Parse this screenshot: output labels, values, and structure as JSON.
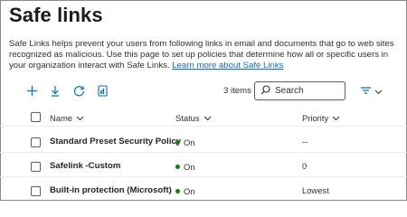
{
  "page": {
    "title": "Safe links",
    "description": "Safe Links helps prevent your users from following links in email and documents that go to web sites recognized as malicious. Use this page to set up policies that determine how all or specific users in your organization interact with Safe Links.",
    "learn_more": "Learn more about Safe Links"
  },
  "toolbar": {
    "items_count": "3 items",
    "search_placeholder": "Search",
    "icons": [
      "add-icon",
      "download-icon",
      "refresh-icon",
      "report-icon",
      "filter-icon"
    ]
  },
  "table": {
    "columns": [
      "Name",
      "Status",
      "Priority"
    ],
    "rows": [
      {
        "name": "Standard Preset Security Policy",
        "status": "On",
        "priority": "--"
      },
      {
        "name": "Safelink -Custom",
        "status": "On",
        "priority": "0"
      },
      {
        "name": "Built-in protection (Microsoft)",
        "status": "On",
        "priority": "Lowest"
      }
    ]
  },
  "colors": {
    "link": "#0f6cbd",
    "accent_icon": "#0f6cbd",
    "status_on": "#107c10"
  }
}
